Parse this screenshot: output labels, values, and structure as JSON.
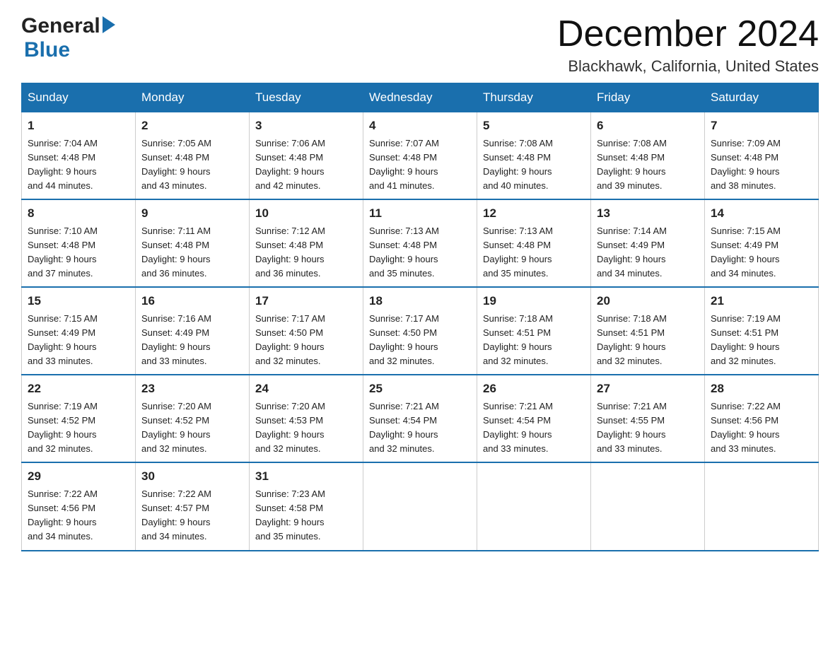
{
  "header": {
    "title": "December 2024",
    "subtitle": "Blackhawk, California, United States",
    "logo_general": "General",
    "logo_blue": "Blue"
  },
  "days_of_week": [
    "Sunday",
    "Monday",
    "Tuesday",
    "Wednesday",
    "Thursday",
    "Friday",
    "Saturday"
  ],
  "weeks": [
    [
      {
        "day": "1",
        "sunrise": "7:04 AM",
        "sunset": "4:48 PM",
        "daylight": "9 hours and 44 minutes."
      },
      {
        "day": "2",
        "sunrise": "7:05 AM",
        "sunset": "4:48 PM",
        "daylight": "9 hours and 43 minutes."
      },
      {
        "day": "3",
        "sunrise": "7:06 AM",
        "sunset": "4:48 PM",
        "daylight": "9 hours and 42 minutes."
      },
      {
        "day": "4",
        "sunrise": "7:07 AM",
        "sunset": "4:48 PM",
        "daylight": "9 hours and 41 minutes."
      },
      {
        "day": "5",
        "sunrise": "7:08 AM",
        "sunset": "4:48 PM",
        "daylight": "9 hours and 40 minutes."
      },
      {
        "day": "6",
        "sunrise": "7:08 AM",
        "sunset": "4:48 PM",
        "daylight": "9 hours and 39 minutes."
      },
      {
        "day": "7",
        "sunrise": "7:09 AM",
        "sunset": "4:48 PM",
        "daylight": "9 hours and 38 minutes."
      }
    ],
    [
      {
        "day": "8",
        "sunrise": "7:10 AM",
        "sunset": "4:48 PM",
        "daylight": "9 hours and 37 minutes."
      },
      {
        "day": "9",
        "sunrise": "7:11 AM",
        "sunset": "4:48 PM",
        "daylight": "9 hours and 36 minutes."
      },
      {
        "day": "10",
        "sunrise": "7:12 AM",
        "sunset": "4:48 PM",
        "daylight": "9 hours and 36 minutes."
      },
      {
        "day": "11",
        "sunrise": "7:13 AM",
        "sunset": "4:48 PM",
        "daylight": "9 hours and 35 minutes."
      },
      {
        "day": "12",
        "sunrise": "7:13 AM",
        "sunset": "4:48 PM",
        "daylight": "9 hours and 35 minutes."
      },
      {
        "day": "13",
        "sunrise": "7:14 AM",
        "sunset": "4:49 PM",
        "daylight": "9 hours and 34 minutes."
      },
      {
        "day": "14",
        "sunrise": "7:15 AM",
        "sunset": "4:49 PM",
        "daylight": "9 hours and 34 minutes."
      }
    ],
    [
      {
        "day": "15",
        "sunrise": "7:15 AM",
        "sunset": "4:49 PM",
        "daylight": "9 hours and 33 minutes."
      },
      {
        "day": "16",
        "sunrise": "7:16 AM",
        "sunset": "4:49 PM",
        "daylight": "9 hours and 33 minutes."
      },
      {
        "day": "17",
        "sunrise": "7:17 AM",
        "sunset": "4:50 PM",
        "daylight": "9 hours and 32 minutes."
      },
      {
        "day": "18",
        "sunrise": "7:17 AM",
        "sunset": "4:50 PM",
        "daylight": "9 hours and 32 minutes."
      },
      {
        "day": "19",
        "sunrise": "7:18 AM",
        "sunset": "4:51 PM",
        "daylight": "9 hours and 32 minutes."
      },
      {
        "day": "20",
        "sunrise": "7:18 AM",
        "sunset": "4:51 PM",
        "daylight": "9 hours and 32 minutes."
      },
      {
        "day": "21",
        "sunrise": "7:19 AM",
        "sunset": "4:51 PM",
        "daylight": "9 hours and 32 minutes."
      }
    ],
    [
      {
        "day": "22",
        "sunrise": "7:19 AM",
        "sunset": "4:52 PM",
        "daylight": "9 hours and 32 minutes."
      },
      {
        "day": "23",
        "sunrise": "7:20 AM",
        "sunset": "4:52 PM",
        "daylight": "9 hours and 32 minutes."
      },
      {
        "day": "24",
        "sunrise": "7:20 AM",
        "sunset": "4:53 PM",
        "daylight": "9 hours and 32 minutes."
      },
      {
        "day": "25",
        "sunrise": "7:21 AM",
        "sunset": "4:54 PM",
        "daylight": "9 hours and 32 minutes."
      },
      {
        "day": "26",
        "sunrise": "7:21 AM",
        "sunset": "4:54 PM",
        "daylight": "9 hours and 33 minutes."
      },
      {
        "day": "27",
        "sunrise": "7:21 AM",
        "sunset": "4:55 PM",
        "daylight": "9 hours and 33 minutes."
      },
      {
        "day": "28",
        "sunrise": "7:22 AM",
        "sunset": "4:56 PM",
        "daylight": "9 hours and 33 minutes."
      }
    ],
    [
      {
        "day": "29",
        "sunrise": "7:22 AM",
        "sunset": "4:56 PM",
        "daylight": "9 hours and 34 minutes."
      },
      {
        "day": "30",
        "sunrise": "7:22 AM",
        "sunset": "4:57 PM",
        "daylight": "9 hours and 34 minutes."
      },
      {
        "day": "31",
        "sunrise": "7:23 AM",
        "sunset": "4:58 PM",
        "daylight": "9 hours and 35 minutes."
      },
      null,
      null,
      null,
      null
    ]
  ],
  "labels": {
    "sunrise": "Sunrise:",
    "sunset": "Sunset:",
    "daylight": "Daylight:"
  },
  "colors": {
    "header_bg": "#1a6fad",
    "header_text": "#ffffff",
    "border": "#1a6fad"
  }
}
